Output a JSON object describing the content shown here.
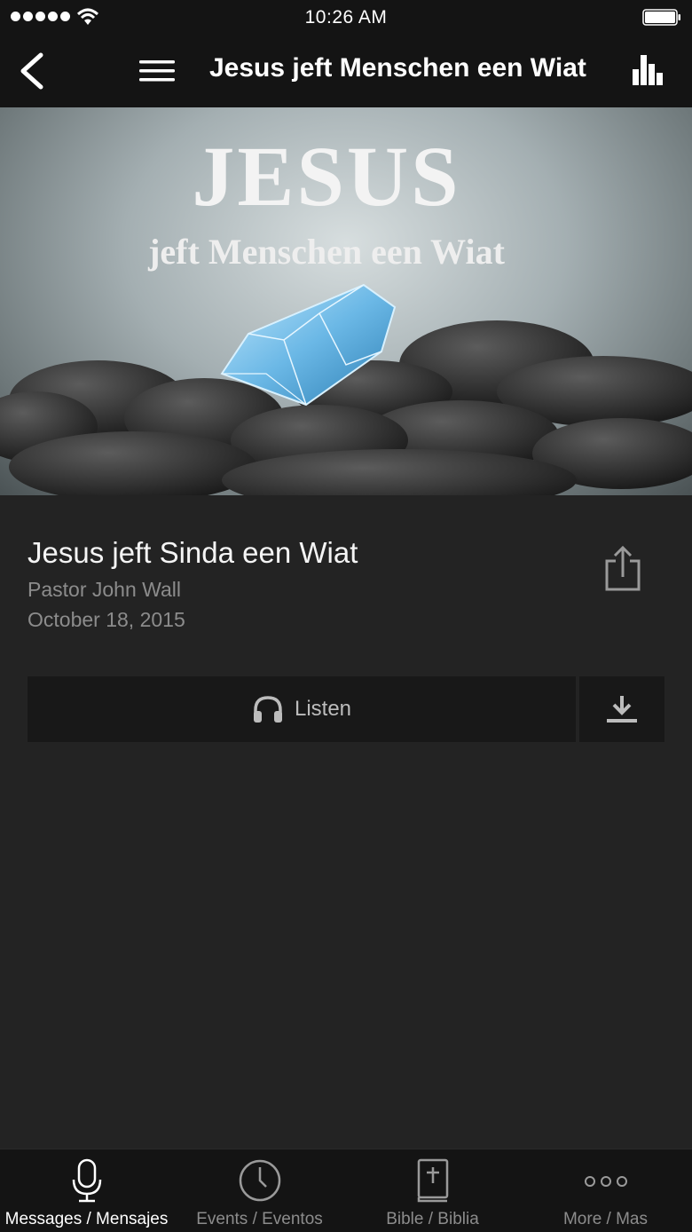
{
  "status_bar": {
    "time": "10:26 AM"
  },
  "nav": {
    "title": "Jesus jeft Menschen een Wiat"
  },
  "hero": {
    "line1": "JESUS",
    "line2": "jeft Menschen een Wiat"
  },
  "message": {
    "title": "Jesus jeft Sinda een Wiat",
    "speaker": "Pastor John Wall",
    "date": "October 18, 2015"
  },
  "actions": {
    "listen_label": "Listen"
  },
  "tabs": [
    {
      "label": "Messages / Mensajes",
      "icon": "microphone-icon",
      "active": true
    },
    {
      "label": "Events / Eventos",
      "icon": "clock-icon",
      "active": false
    },
    {
      "label": "Bible / Biblia",
      "icon": "bible-icon",
      "active": false
    },
    {
      "label": "More / Mas",
      "icon": "more-icon",
      "active": false
    }
  ],
  "colors": {
    "background": "#232323",
    "bars": "#141414",
    "button": "#181818",
    "muted_text": "#8c8c8c"
  }
}
